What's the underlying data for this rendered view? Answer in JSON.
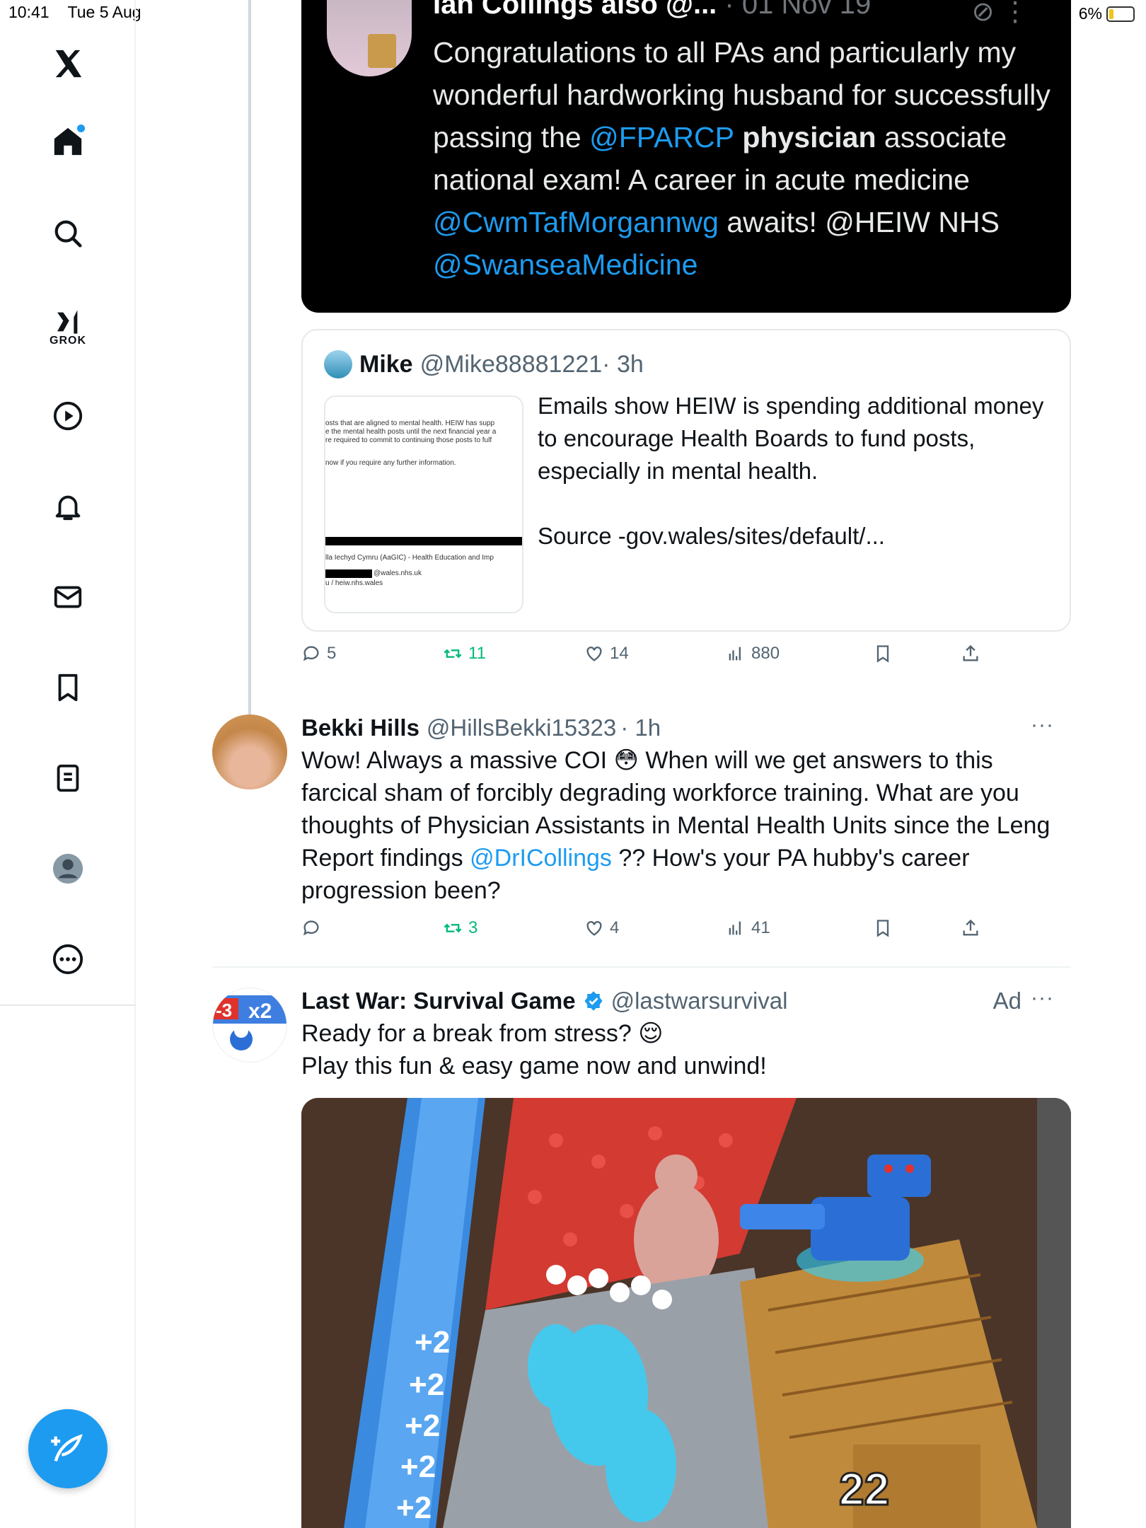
{
  "status_bar": {
    "time": "10:41",
    "date": "Tue 5 Aug",
    "battery": "6%"
  },
  "sidebar": {
    "items": [
      {
        "name": "x-logo"
      },
      {
        "name": "home"
      },
      {
        "name": "search"
      },
      {
        "name": "grok",
        "label": "GROK"
      },
      {
        "name": "videos"
      },
      {
        "name": "notifications"
      },
      {
        "name": "messages"
      },
      {
        "name": "bookmarks"
      },
      {
        "name": "lists"
      },
      {
        "name": "profile"
      },
      {
        "name": "more"
      }
    ],
    "compose_icon": "compose-post-icon"
  },
  "quoted_post": {
    "name": "Ian Collings also @...",
    "date": "· 01 Nov 19",
    "text_parts": [
      "Congratulations to all PAs and particularly my wonderful hardworking husband for successfully passing the ",
      "@FPARCP",
      " physician",
      " associate national exam! A career in acute medicine ",
      "@CwmTafMorgannwg",
      " awaits! @HEIW NHS ",
      "@SwanseaMedicine"
    ]
  },
  "mike_post": {
    "name": "Mike",
    "handle": "@Mike88881221",
    "time": "· 3h",
    "text": "Emails show HEIW is spending additional money to encourage Health Boards to fund posts, especially in mental health.",
    "source": "Source -gov.wales/sites/default/...",
    "image_lines": [
      "osts that are aligned to mental health. HEIW has supp",
      "e the mental health posts until the next financial year a",
      "re required to commit to continuing those posts to fulf",
      "now if you require any further information.",
      "lla Iechyd Cymru (AaGIC) - Health Education and Imp",
      "@wales.nhs.uk",
      "u / heiw.nhs.wales"
    ],
    "stats": {
      "replies": "5",
      "reposts": "11",
      "likes": "14",
      "views": "880"
    }
  },
  "bekki_post": {
    "name": "Bekki Hills",
    "handle": "@HillsBekki15323",
    "time": "· 1h",
    "text_a": "Wow! Always a massive COI 😳 When will we get answers to this farcical sham of forcibly degrading workforce training. What are you thoughts of Physician Assistants in Mental Health Units since the Leng Report findings ",
    "mention": "@DrICollings",
    "text_b": " ?? How's your PA hubby's career progression been?",
    "stats": {
      "replies": "",
      "reposts": "3",
      "likes": "4",
      "views": "41"
    }
  },
  "ad_post": {
    "name": "Last War: Survival Game",
    "handle": "@lastwarsurvival",
    "ad_label": "Ad",
    "line1": "Ready for a break from stress? 😌",
    "line2": "Play this fun & easy game now and unwind!",
    "image_text": {
      "multiplier": "x2",
      "minus": "-3",
      "gate": "+2",
      "crate": "22"
    }
  },
  "colors": {
    "accent": "#1d9bf0",
    "repost": "#00ba7c",
    "muted": "#536471"
  }
}
